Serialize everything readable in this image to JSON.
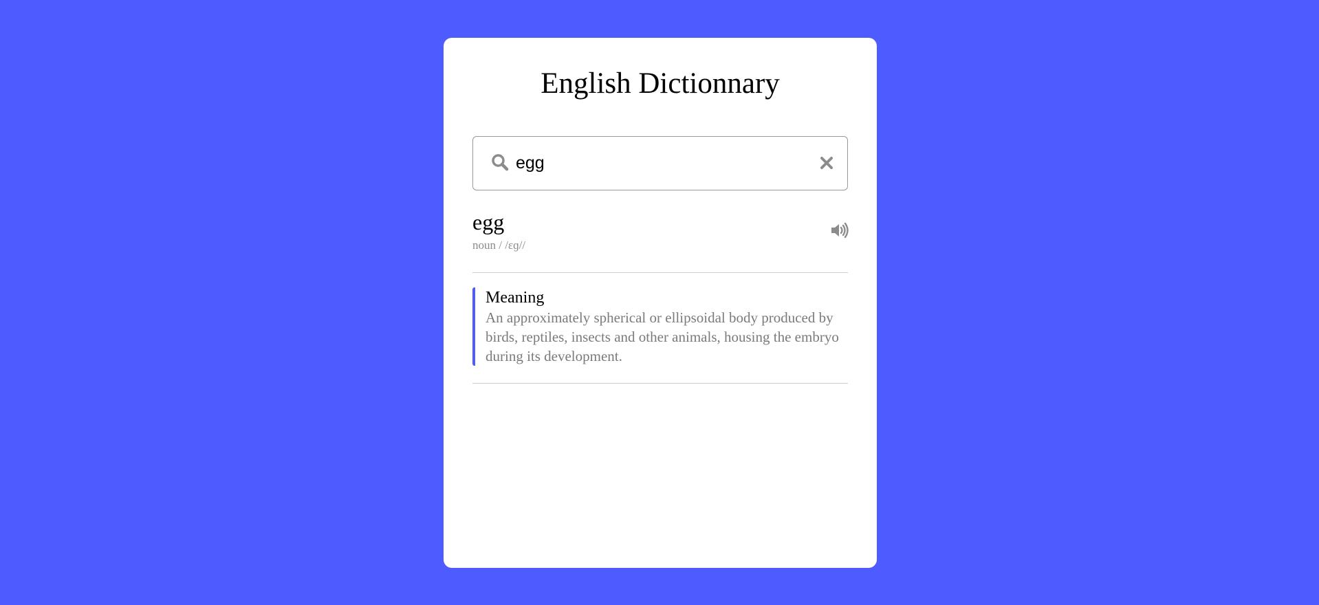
{
  "page": {
    "background_color": "#4e5bfe",
    "accent_color": "#4e5bfe"
  },
  "card": {
    "title": "English Dictionnary"
  },
  "search": {
    "value": "egg",
    "icon": "search-icon",
    "clear_icon": "close-icon"
  },
  "result": {
    "word": "egg",
    "phonetic": "noun / /ɛɡ//",
    "audio_icon": "speaker-icon",
    "meaning_label": "Meaning",
    "meaning_text": "An approximately spherical or ellipsoidal body produced by birds, reptiles, insects and other animals, housing the embryo during its development."
  }
}
